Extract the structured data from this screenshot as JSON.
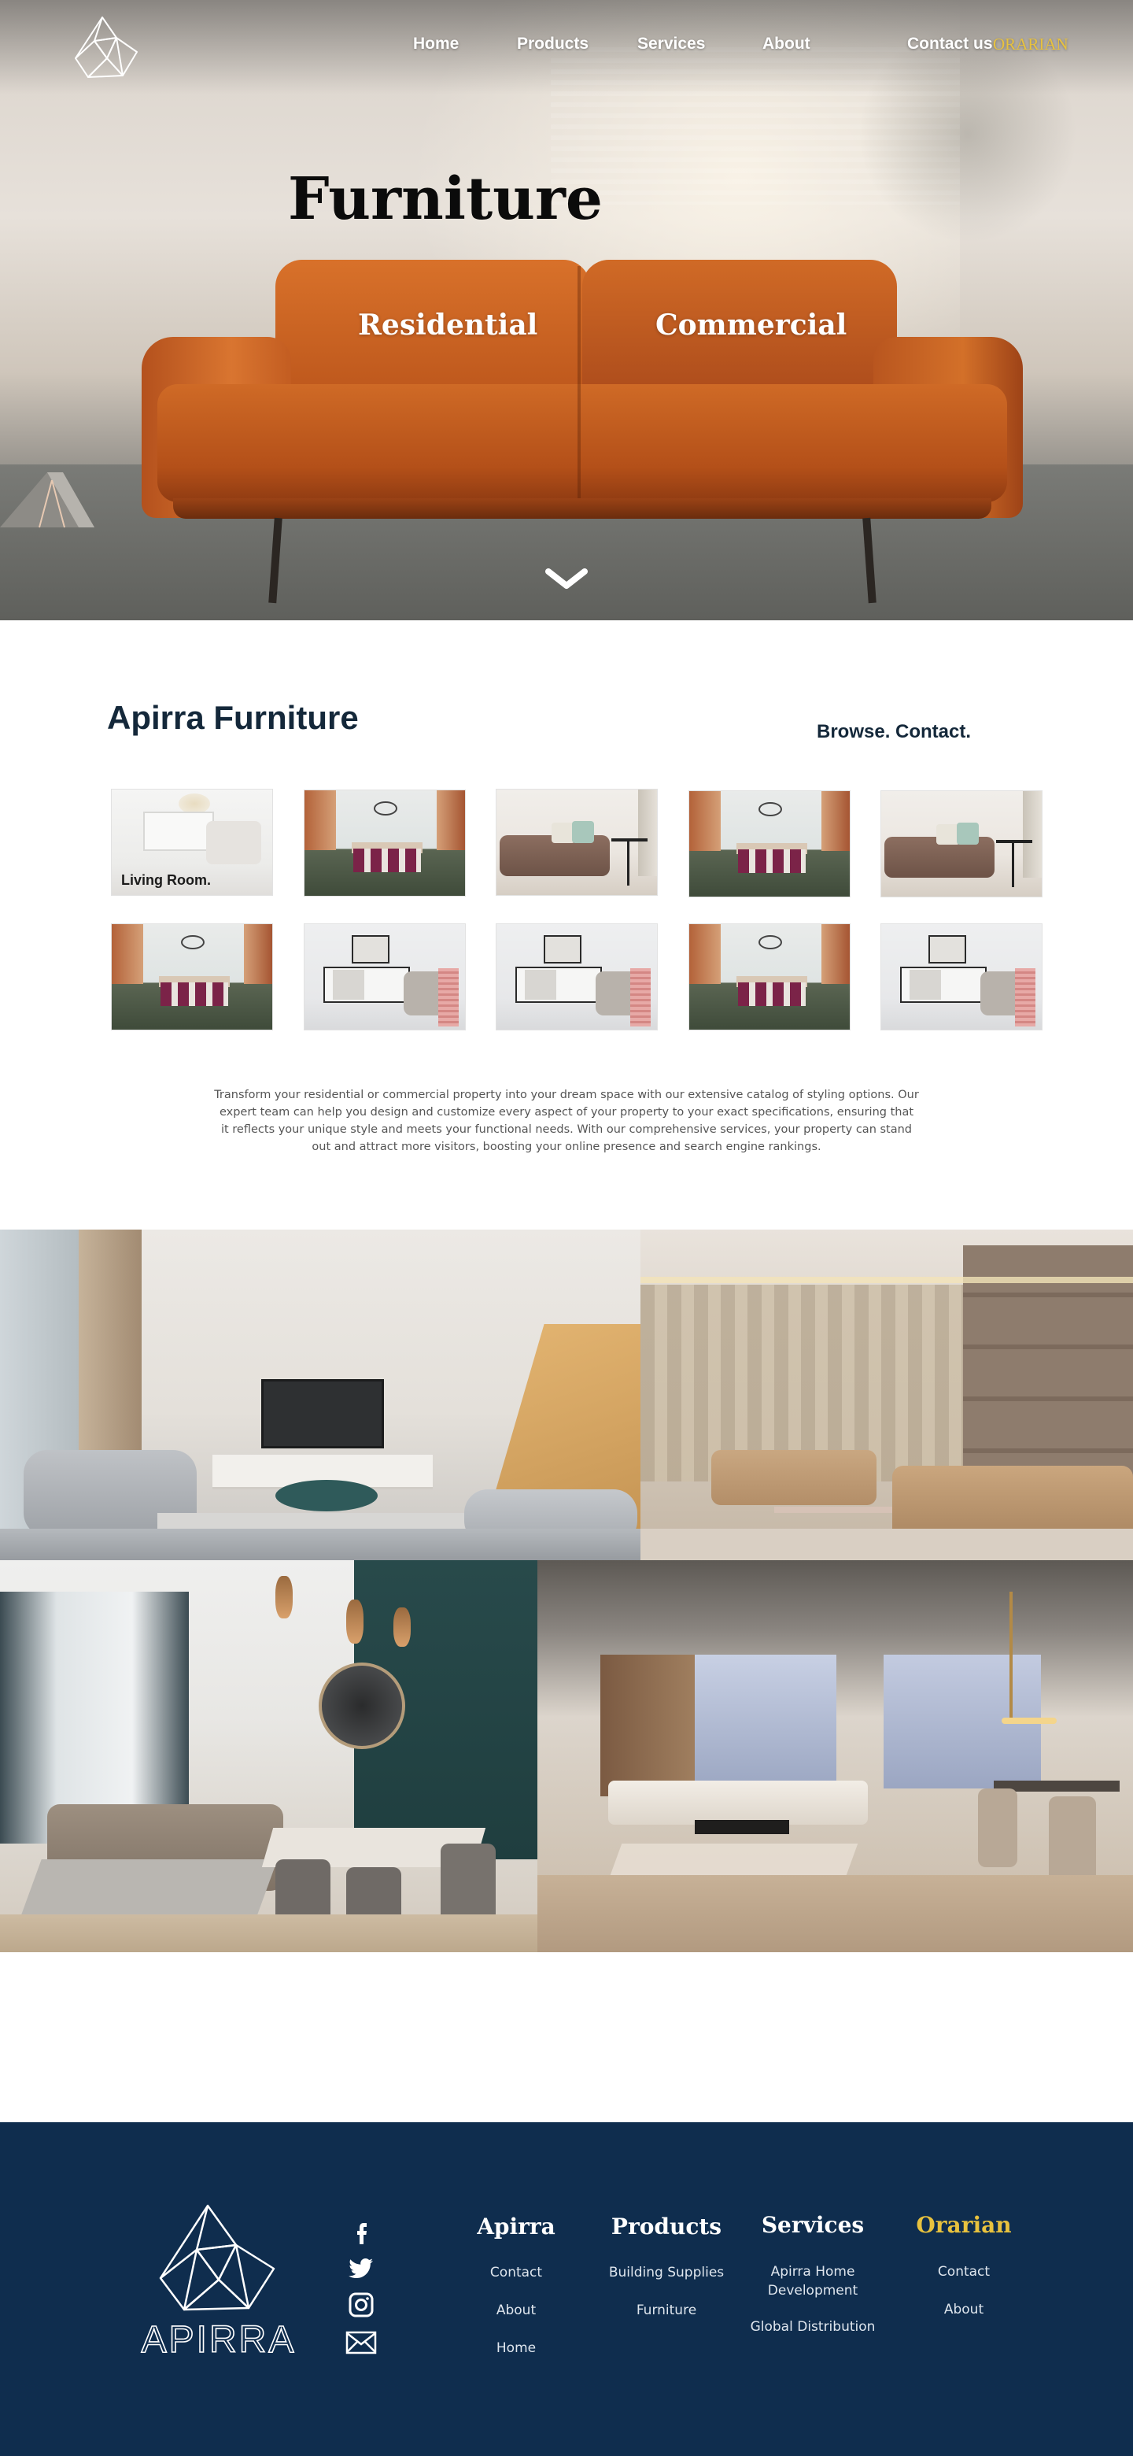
{
  "nav": {
    "items": [
      "Home",
      "Products",
      "Services",
      "About",
      "Contact us"
    ],
    "brand_label": "ORARIAN"
  },
  "hero": {
    "title": "Furniture",
    "categories": [
      "Residential",
      "Commercial"
    ],
    "scroll_icon": "chevron-down-icon"
  },
  "furniture": {
    "title": "Apirra Furniture",
    "tagline": "Browse. Contact.",
    "thumbs": [
      {
        "scene": "living-room",
        "caption": "Living Room."
      },
      {
        "scene": "dining-room"
      },
      {
        "scene": "sofa"
      },
      {
        "scene": "dining-room"
      },
      {
        "scene": "sofa"
      },
      {
        "scene": "dining-room"
      },
      {
        "scene": "console"
      },
      {
        "scene": "console"
      },
      {
        "scene": "dining-room"
      },
      {
        "scene": "console"
      }
    ],
    "description": "Transform your residential or commercial property into your dream space with our extensive catalog of styling options. Our expert team can help you design and customize every aspect of your property to your exact specifications, ensuring that it reflects your unique style and meets your functional needs. With our comprehensive services, your property can stand out and attract more visitors, boosting your online presence and search engine rankings."
  },
  "gallery": [
    "living-room-staircase",
    "beige-lounge",
    "teal-living-dining",
    "open-plan-lounge"
  ],
  "footer": {
    "wordmark": "APIRRA",
    "social": [
      "facebook-icon",
      "twitter-icon",
      "instagram-icon",
      "mail-icon"
    ],
    "columns": [
      {
        "title": "Apirra",
        "links": [
          "Contact",
          "About",
          "Home"
        ]
      },
      {
        "title": "Products",
        "links": [
          "Building Supplies",
          "Furniture"
        ]
      },
      {
        "title": "Services",
        "links": [
          "Apirra Home Development",
          "Global Distribution"
        ]
      },
      {
        "title": "Orarian",
        "links": [
          "Contact",
          "About"
        ]
      }
    ]
  },
  "colors": {
    "navy": "#0f2d4e",
    "gold": "#e8c23e",
    "heading": "#14283a",
    "sofa": "#c45f22"
  }
}
